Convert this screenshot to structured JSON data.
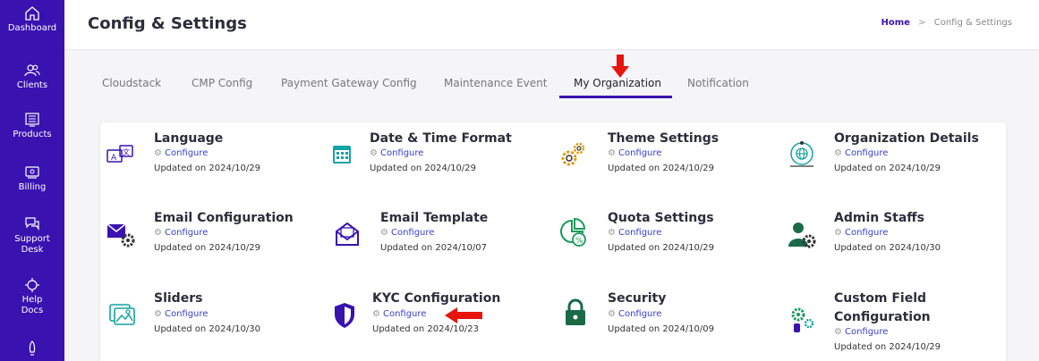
{
  "sidebar": {
    "items": [
      {
        "label": "Dashboard",
        "icon": "home-icon"
      },
      {
        "label": "Clients",
        "icon": "users-icon"
      },
      {
        "label": "Products",
        "icon": "server-icon"
      },
      {
        "label": "Billing",
        "icon": "billing-icon"
      },
      {
        "label": "Support Desk",
        "icon": "chat-icon"
      },
      {
        "label": "Help Docs",
        "icon": "help-icon"
      },
      {
        "label": "",
        "icon": "rocket-icon"
      }
    ]
  },
  "header": {
    "title": "Config & Settings",
    "breadcrumb": {
      "home": "Home",
      "separator": ">",
      "current": "Config & Settings"
    }
  },
  "tabs": [
    {
      "label": "Cloudstack"
    },
    {
      "label": "CMP Config"
    },
    {
      "label": "Payment Gateway Config"
    },
    {
      "label": "Maintenance Event"
    },
    {
      "label": "My Organization",
      "active": true
    },
    {
      "label": "Notification"
    }
  ],
  "settings": [
    {
      "title": "Language",
      "action": "Configure",
      "updated": "Updated on 2024/10/29",
      "icon": "language-icon"
    },
    {
      "title": "Date & Time Format",
      "action": "Configure",
      "updated": "Updated on 2024/10/29",
      "icon": "calendar-icon"
    },
    {
      "title": "Theme Settings",
      "action": "Configure",
      "updated": "Updated on 2024/10/29",
      "icon": "gears-icon"
    },
    {
      "title": "Organization Details",
      "action": "Configure",
      "updated": "Updated on 2024/10/29",
      "icon": "globe-icon"
    },
    {
      "title": "Email Configuration",
      "action": "Configure",
      "updated": "Updated on 2024/10/29",
      "icon": "email-config-icon"
    },
    {
      "title": "Email Template",
      "action": "Configure",
      "updated": "Updated on 2024/10/07",
      "icon": "email-template-icon"
    },
    {
      "title": "Quota Settings",
      "action": "Configure",
      "updated": "Updated on 2024/10/29",
      "icon": "quota-icon"
    },
    {
      "title": "Admin Staffs",
      "action": "Configure",
      "updated": "Updated on 2024/10/30",
      "icon": "admin-icon"
    },
    {
      "title": "Sliders",
      "action": "Configure",
      "updated": "Updated on 2024/10/30",
      "icon": "sliders-icon"
    },
    {
      "title": "KYC Configuration",
      "action": "Configure",
      "updated": "Updated on 2024/10/23",
      "icon": "shield-icon"
    },
    {
      "title": "Security",
      "action": "Configure",
      "updated": "Updated on 2024/10/09",
      "icon": "lock-icon"
    },
    {
      "title": "Custom Field",
      "title2": "Configuration",
      "action": "Configure",
      "updated": "Updated on 2024/10/29",
      "icon": "custom-field-icon"
    }
  ],
  "colors": {
    "brand": "#3a12b0",
    "link": "#3a40c8",
    "annotation": "#e8150f"
  }
}
